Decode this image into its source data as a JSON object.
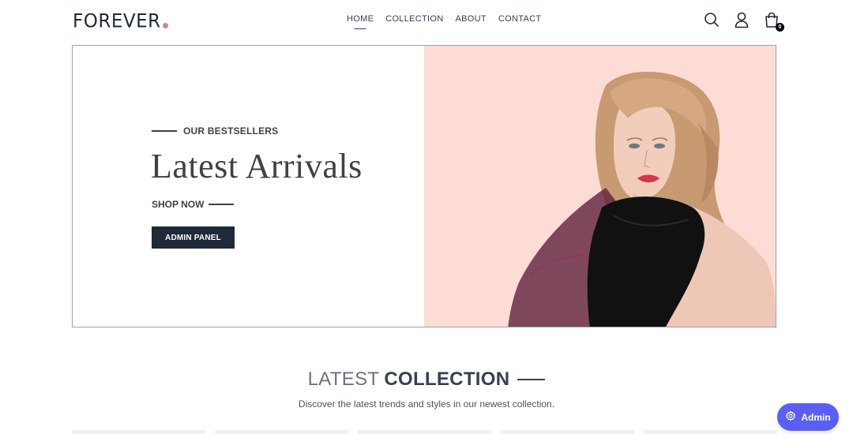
{
  "brand": {
    "name": "FOREVER",
    "dot_color": "#c586a5"
  },
  "nav": {
    "links": [
      {
        "label": "HOME",
        "active": true
      },
      {
        "label": "COLLECTION",
        "active": false
      },
      {
        "label": "ABOUT",
        "active": false
      },
      {
        "label": "CONTACT",
        "active": false
      }
    ],
    "icons": [
      "search-icon",
      "profile-icon",
      "cart-icon"
    ],
    "cart_count": "0"
  },
  "hero": {
    "eyebrow": "OUR BESTSELLERS",
    "title": "Latest Arrivals",
    "shop_now": "SHOP NOW",
    "admin_button": "ADMIN PANEL",
    "image_bg": "#fddcd6"
  },
  "collection": {
    "title_light": "LATEST",
    "title_bold": "COLLECTION",
    "subtitle": "Discover the latest trends and styles in our newest collection."
  },
  "fab": {
    "label": "Admin",
    "icon": "gear-icon",
    "color": "#5b5ef4"
  }
}
